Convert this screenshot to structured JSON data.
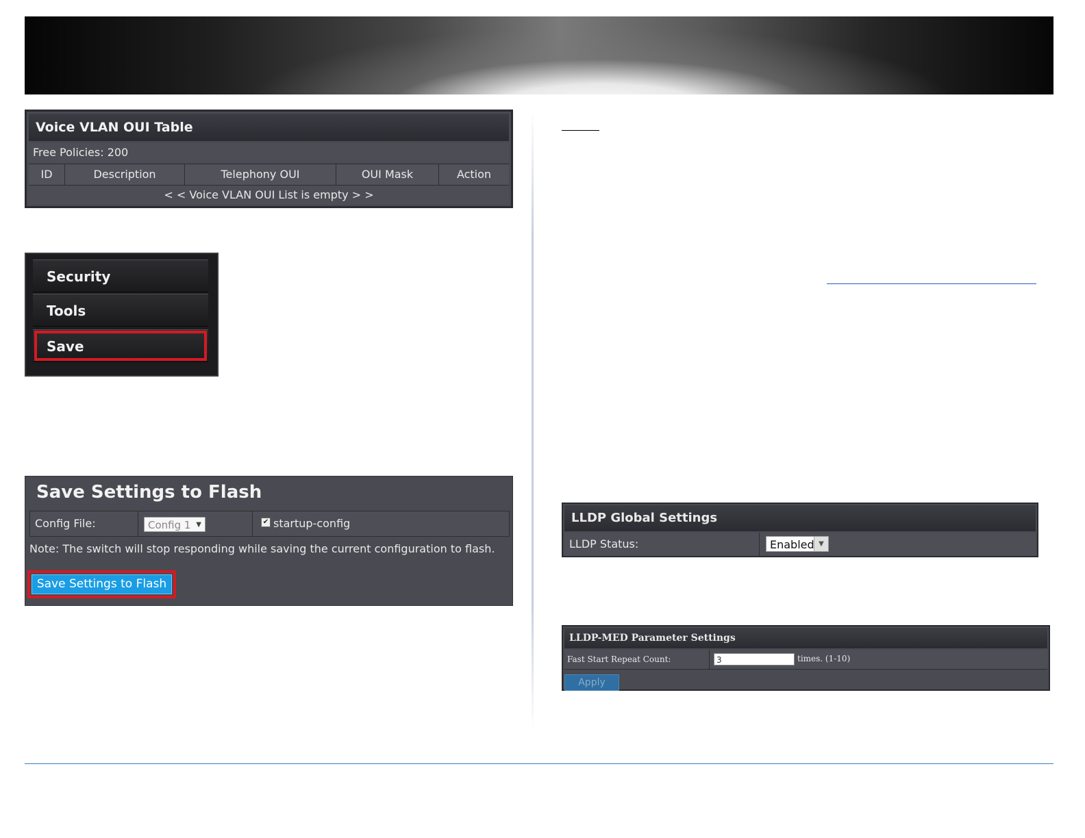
{
  "oui_table": {
    "title": "Voice VLAN OUI Table",
    "free_policies": "Free Policies: 200",
    "columns": [
      "ID",
      "Description",
      "Telephony OUI",
      "OUI Mask",
      "Action"
    ],
    "empty_message": "< < Voice VLAN OUI List is empty > >"
  },
  "menu": {
    "items": [
      "Security",
      "Tools",
      "Save"
    ],
    "highlight_color": "#d51a22"
  },
  "save_flash": {
    "title": "Save Settings to Flash",
    "config_label": "Config File:",
    "config_value": "Config 1",
    "startup_label": "startup-config",
    "startup_checked": true,
    "note": "Note: The switch will stop responding while saving the current configuration to flash.",
    "button_label": "Save Settings to Flash",
    "button_color": "#1a9de4"
  },
  "lldp_global": {
    "title": "LLDP Global Settings",
    "status_label": "LLDP Status:",
    "status_value": "Enabled"
  },
  "lldp_med": {
    "title": "LLDP-MED Parameter Settings",
    "fast_start_label": "Fast Start Repeat Count:",
    "fast_start_value": "3",
    "fast_start_hint": "times. (1-10)",
    "apply_label": "Apply"
  }
}
